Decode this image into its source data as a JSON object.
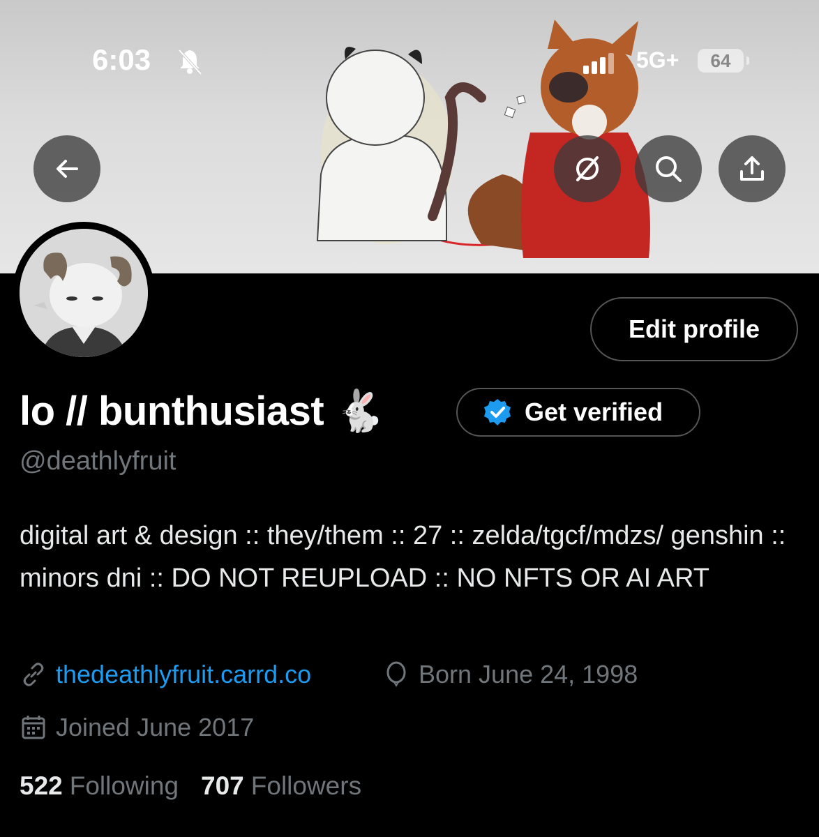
{
  "status_bar": {
    "time": "6:03",
    "network": "5G+",
    "battery": "64"
  },
  "header": {
    "back_icon": "arrow-left-icon",
    "grok_icon": "slashed-circle-icon",
    "search_icon": "search-icon",
    "share_icon": "share-icon"
  },
  "profile": {
    "display_name": "lo // bunthusiast 🐇",
    "handle": "@deathlyfruit",
    "edit_label": "Edit profile",
    "verify_label": "Get verified",
    "bio": "digital art & design :: they/them :: 27 :: zelda/tgcf/mdzs/ genshin :: minors dni :: DO NOT REUPLOAD :: NO NFTS OR AI ART",
    "website": "thedeathlyfruit.carrd.co",
    "birthday": "Born June 24, 1998",
    "joined": "Joined June 2017",
    "following_count": "522",
    "following_label": "Following",
    "followers_count": "707",
    "followers_label": "Followers"
  },
  "colors": {
    "accent": "#1d9bf0",
    "muted": "#71767b",
    "background": "#000000"
  }
}
